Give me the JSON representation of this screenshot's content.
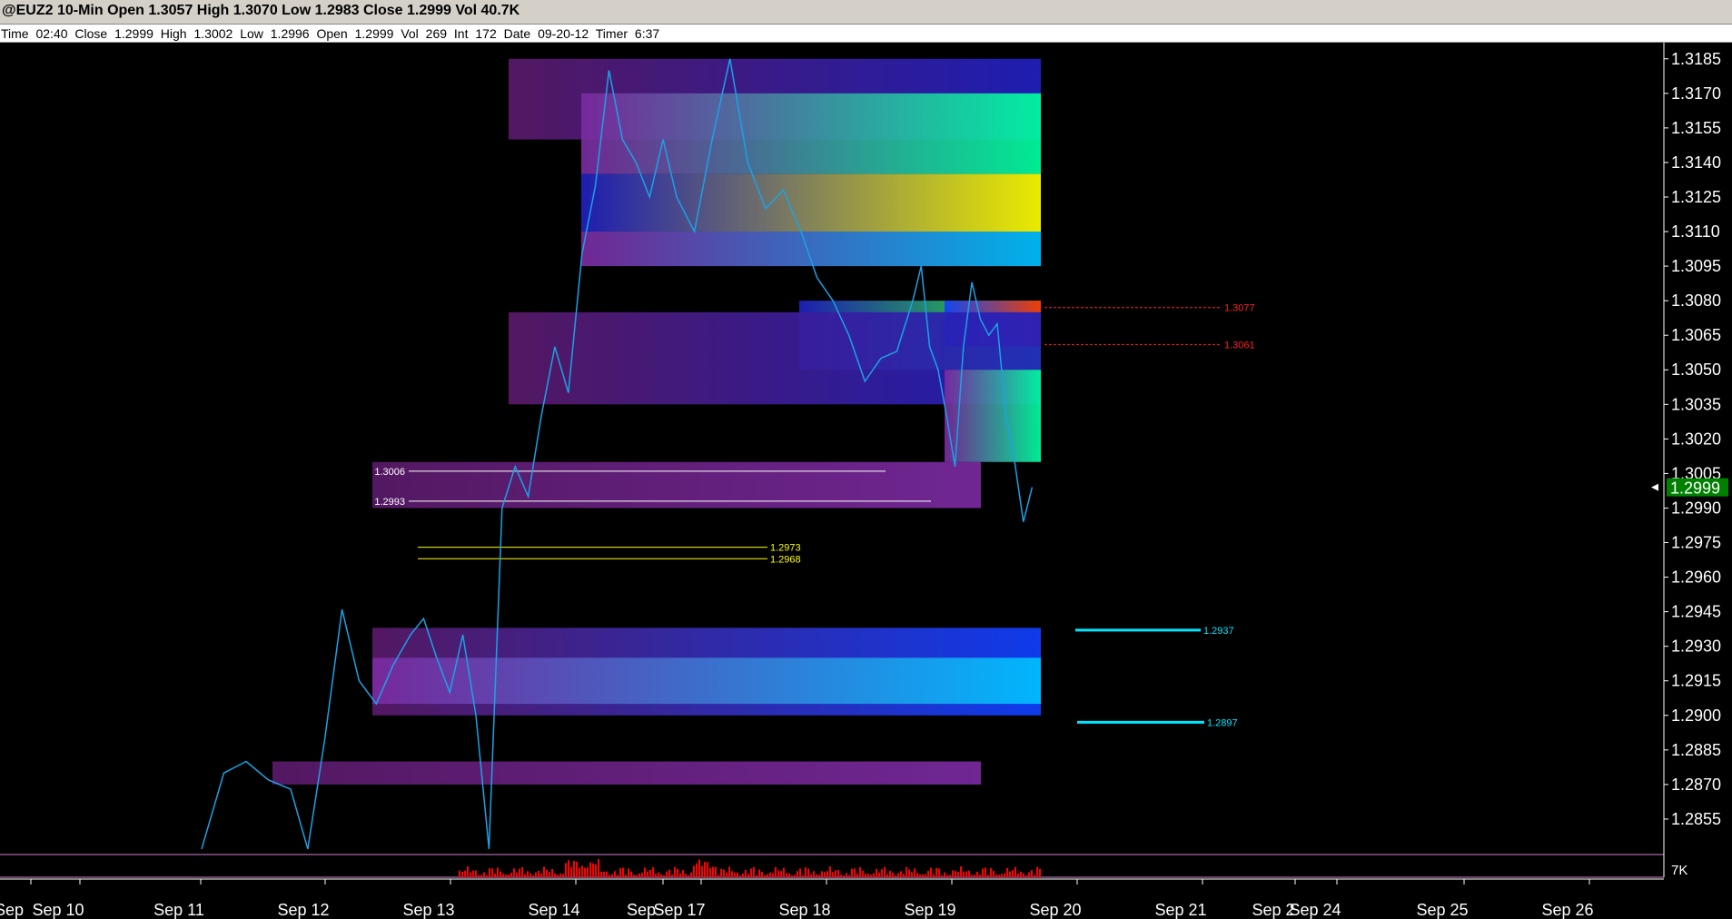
{
  "title_bar": "@EUZ2 10-Min Open 1.3057 High 1.3070 Low 1.2983 Close 1.2999 Vol 40.7K",
  "info_bar": "Time 02:40  Close 1.2999  High 1.3002  Low 1.2996  Open 1.2999  Vol 269  Int 172  Date 09-20-12  Timer 6:37",
  "colors": {
    "price_line": "#1aa3e6",
    "volume": "#ff0000",
    "axis": "#ffffff",
    "divider": "#d080d0",
    "last_price_box": "#008000"
  },
  "chart_data": {
    "type": "line",
    "symbol": "@EUZ2",
    "interval": "10-Min",
    "x_tick_labels": [
      "Sep",
      "Sep 10",
      "Sep 11",
      "Sep 12",
      "Sep 13",
      "Sep 14",
      "Sep",
      "Sep 17",
      "Sep 18",
      "Sep 19",
      "Sep 20",
      "Sep 21",
      "Sep 2",
      "Sep 24",
      "Sep 25",
      "Sep 26"
    ],
    "y_tick_labels": [
      "1.3185",
      "1.3170",
      "1.3155",
      "1.3140",
      "1.3125",
      "1.3110",
      "1.3095",
      "1.3080",
      "1.3065",
      "1.3050",
      "1.3035",
      "1.3020",
      "1.3005",
      "1.2990",
      "1.2975",
      "1.2960",
      "1.2945",
      "1.2930",
      "1.2915",
      "1.2900",
      "1.2885",
      "1.2870",
      "1.2855"
    ],
    "ylim": [
      1.284,
      1.3192
    ],
    "volume_axis_label": "7K",
    "last_price": "1.2999",
    "price_series": {
      "name": "",
      "points": [
        [
          "Sep 11",
          1.2842
        ],
        [
          "Sep 11",
          1.2875
        ],
        [
          "Sep 11",
          1.288
        ],
        [
          "Sep 11",
          1.2872
        ],
        [
          "Sep 12",
          1.2868
        ],
        [
          "Sep 12",
          1.2842
        ],
        [
          "Sep 12",
          1.289
        ],
        [
          "Sep 12",
          1.2946
        ],
        [
          "Sep 12",
          1.2915
        ],
        [
          "Sep 12",
          1.2905
        ],
        [
          "Sep 12",
          1.2922
        ],
        [
          "Sep 13",
          1.2935
        ],
        [
          "Sep 13",
          1.2942
        ],
        [
          "Sep 13",
          1.2925
        ],
        [
          "Sep 13",
          1.291
        ],
        [
          "Sep 13",
          1.2935
        ],
        [
          "Sep 13",
          1.29
        ],
        [
          "Sep 13",
          1.2842
        ],
        [
          "Sep 13",
          1.299
        ],
        [
          "Sep 13",
          1.3008
        ],
        [
          "Sep 13",
          1.2995
        ],
        [
          "Sep 14",
          1.303
        ],
        [
          "Sep 14",
          1.306
        ],
        [
          "Sep 14",
          1.304
        ],
        [
          "Sep 14",
          1.31
        ],
        [
          "Sep 14",
          1.313
        ],
        [
          "Sep 14",
          1.318
        ],
        [
          "Sep 14",
          1.315
        ],
        [
          "Sep 14",
          1.314
        ],
        [
          "Sep 14",
          1.3125
        ],
        [
          "Sep 14",
          1.315
        ],
        [
          "Sep 17",
          1.3125
        ],
        [
          "Sep 17",
          1.311
        ],
        [
          "Sep 17",
          1.315
        ],
        [
          "Sep 17",
          1.3185
        ],
        [
          "Sep 17",
          1.314
        ],
        [
          "Sep 17",
          1.312
        ],
        [
          "Sep 17",
          1.3128
        ],
        [
          "Sep 18",
          1.311
        ],
        [
          "Sep 18",
          1.309
        ],
        [
          "Sep 18",
          1.308
        ],
        [
          "Sep 18",
          1.3065
        ],
        [
          "Sep 18",
          1.3045
        ],
        [
          "Sep 18",
          1.3055
        ],
        [
          "Sep 18",
          1.3058
        ],
        [
          "Sep 19",
          1.308
        ],
        [
          "Sep 19",
          1.3095
        ],
        [
          "Sep 19",
          1.306
        ],
        [
          "Sep 19",
          1.305
        ],
        [
          "Sep 19",
          1.303
        ],
        [
          "Sep 19",
          1.3008
        ],
        [
          "Sep 19",
          1.306
        ],
        [
          "Sep 19",
          1.3088
        ],
        [
          "Sep 19",
          1.3072
        ],
        [
          "Sep 19",
          1.3065
        ],
        [
          "Sep 20",
          1.307
        ],
        [
          "Sep 20",
          1.303
        ],
        [
          "Sep 20",
          1.301
        ],
        [
          "Sep 20",
          1.2984
        ],
        [
          "Sep 20",
          1.2999
        ]
      ]
    },
    "price_levels": [
      {
        "label": "1.3077",
        "color": "#ff2020",
        "style": "dashed"
      },
      {
        "label": "1.3061",
        "color": "#ff2020",
        "style": "dashed"
      },
      {
        "label": "1.3006",
        "color": "#ffffff",
        "style": "solid"
      },
      {
        "label": "1.2993",
        "color": "#ffffff",
        "style": "solid"
      },
      {
        "label": "1.2973",
        "color": "#ffff00",
        "style": "solid"
      },
      {
        "label": "1.2968",
        "color": "#ffff00",
        "style": "solid"
      },
      {
        "label": "1.2937",
        "color": "#00e5ff",
        "style": "solid"
      },
      {
        "label": "1.2897",
        "color": "#00e5ff",
        "style": "solid"
      }
    ],
    "volume_profile_heatmap": {
      "colorscale": [
        "#2a0a2a",
        "#5a1a6a",
        "#7a2aa0",
        "#2020c0",
        "#1040ff",
        "#00c0ff",
        "#00ffa0",
        "#30ff30",
        "#ffff00",
        "#ff8000",
        "#ff3000"
      ],
      "bands": [
        {
          "from": "Sep 14",
          "to": "Sep 20",
          "price_low": 1.315,
          "price_high": 1.3185,
          "intensity": 0.3
        },
        {
          "from": "Sep 17",
          "to": "Sep 20",
          "price_low": 1.3135,
          "price_high": 1.317,
          "intensity": 0.6
        },
        {
          "from": "Sep 17",
          "to": "Sep 20",
          "price_low": 1.311,
          "price_high": 1.3135,
          "intensity": 0.75
        },
        {
          "from": "Sep 17",
          "to": "Sep 20",
          "price_low": 1.3095,
          "price_high": 1.311,
          "intensity": 0.5
        },
        {
          "from": "Sep 18",
          "to": "Sep 20",
          "price_low": 1.305,
          "price_high": 1.308,
          "intensity": 0.7
        },
        {
          "from": "Sep 19",
          "to": "Sep 20",
          "price_low": 1.306,
          "price_high": 1.308,
          "intensity": 0.95
        },
        {
          "from": "Sep 14",
          "to": "Sep 20",
          "price_low": 1.3035,
          "price_high": 1.3075,
          "intensity": 0.25
        },
        {
          "from": "Sep 19",
          "to": "Sep 20",
          "price_low": 1.301,
          "price_high": 1.305,
          "intensity": 0.55
        },
        {
          "from": "Sep 13",
          "to": "Sep 19",
          "price_low": 1.299,
          "price_high": 1.301,
          "intensity": 0.2
        },
        {
          "from": "Sep 13",
          "to": "Sep 20",
          "price_low": 1.29,
          "price_high": 1.2938,
          "intensity": 0.35
        },
        {
          "from": "Sep 13",
          "to": "Sep 20",
          "price_low": 1.2905,
          "price_high": 1.2925,
          "intensity": 0.45
        },
        {
          "from": "Sep 12",
          "to": "Sep 19",
          "price_low": 1.287,
          "price_high": 1.288,
          "intensity": 0.15
        }
      ]
    },
    "grid": false
  }
}
